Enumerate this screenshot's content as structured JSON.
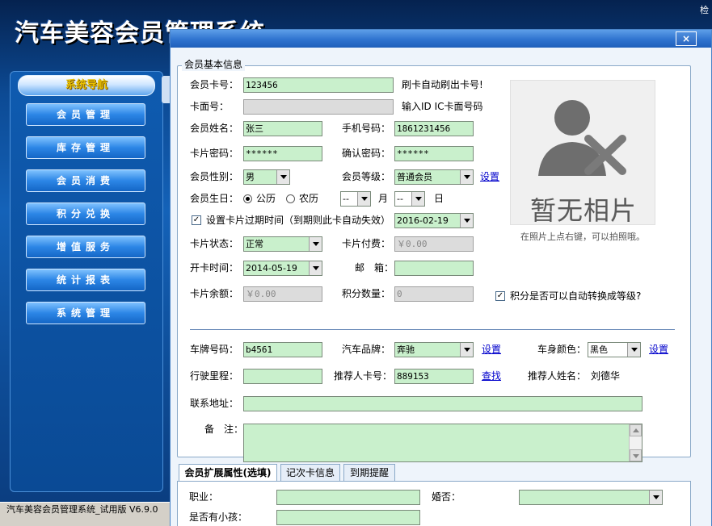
{
  "app": {
    "title": "汽车美容会员管理系统",
    "topright": "检",
    "status": "汽车美容会员管理系统_试用版 V6.9.0"
  },
  "nav": {
    "header": "系统导航",
    "items": [
      "会员管理",
      "库存管理",
      "会员消费",
      "积分兑换",
      "增值服务",
      "统计报表",
      "系统管理"
    ]
  },
  "dialog": {
    "close": "×",
    "group_title": "会员基本信息",
    "labels": {
      "card_no": "会员卡号：",
      "card_face": "卡面号：",
      "name": "会员姓名：",
      "mobile": "手机号码：",
      "password": "卡片密码：",
      "confirm": "确认密码：",
      "gender": "会员性别：",
      "level": "会员等级：",
      "birthday": "会员生日：",
      "solar": "公历",
      "lunar": "农历",
      "month": "月",
      "day": "日",
      "expiry": "设置卡片过期时间（到期则此卡自动失效）",
      "status": "卡片状态：",
      "fee": "卡片付费：",
      "open_date": "开卡时间：",
      "email": "邮　箱：",
      "balance": "卡片余额：",
      "points": "积分数量：",
      "auto_level": "积分是否可以自动转换成等级?",
      "plate": "车牌号码：",
      "brand": "汽车品牌：",
      "color": "车身颜色：",
      "mileage": "行驶里程：",
      "referrer_card": "推荐人卡号：",
      "referrer_name": "推荐人姓名：",
      "address": "联系地址：",
      "remark": "备　注："
    },
    "hints": {
      "card_no": "刷卡自动刷出卡号!",
      "card_face": "输入ID IC卡面号码"
    },
    "values": {
      "card_no": "123456",
      "card_face": "",
      "name": "张三",
      "mobile": "1861231456",
      "password": "******",
      "confirm": "******",
      "gender": "男",
      "level": "普通会员",
      "birth_month": "--",
      "birth_day": "--",
      "expiry_date": "2016-02-19",
      "status": "正常",
      "fee": "￥0.00",
      "open_date": "2014-05-19",
      "email": "",
      "balance": "￥0.00",
      "points": "0",
      "plate": "b4561",
      "brand": "奔驰",
      "color": "黑色",
      "mileage": "",
      "referrer_card": "889153",
      "referrer_name": "刘德华",
      "address": "",
      "remark": ""
    },
    "links": {
      "set_level": "设置",
      "set_brand": "设置",
      "set_color": "设置",
      "search": "查找"
    },
    "photo": {
      "text": "暂无相片",
      "hint": "在照片上点右键，可以拍照哦。"
    },
    "tabs": [
      "会员扩展属性(选填)",
      "记次卡信息",
      "到期提醒"
    ],
    "ext": {
      "job": "职业：",
      "married": "婚否：",
      "kids": "是否有小孩："
    }
  }
}
